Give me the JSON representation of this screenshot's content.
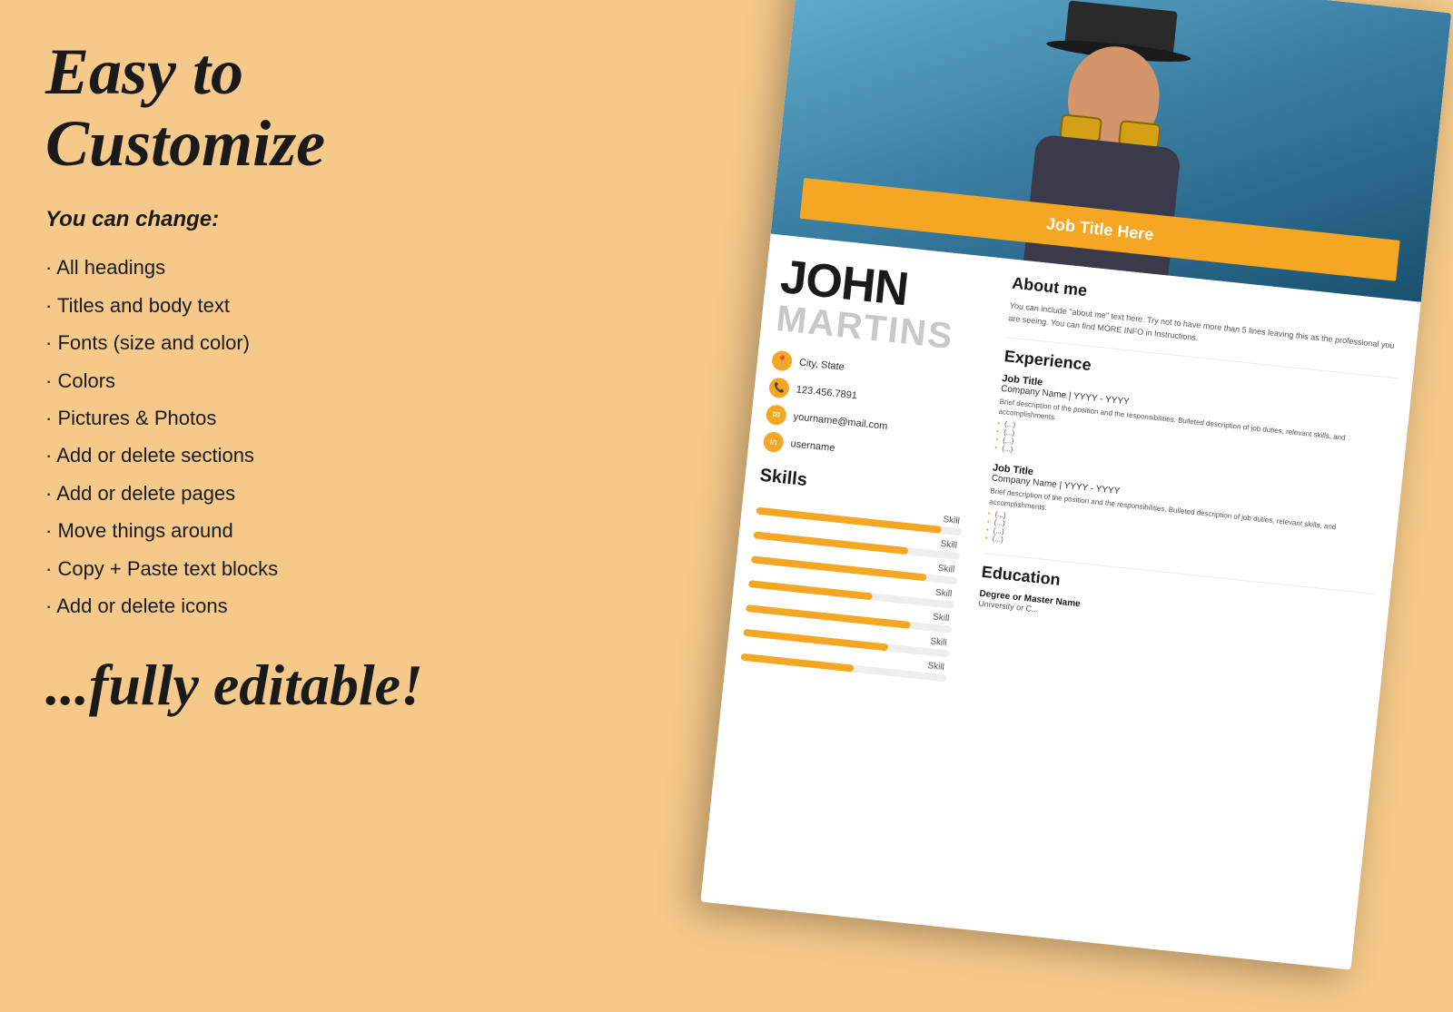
{
  "left": {
    "main_title": "Easy to Customize",
    "subtitle": "You can change:",
    "features": [
      "All headings",
      "Titles and body text",
      "Fonts (size and color)",
      "Colors",
      "Pictures & Photos",
      "Add or delete sections",
      "Add or delete pages",
      "Move things around",
      "Copy + Paste text blocks",
      "Add or delete icons"
    ],
    "tagline": "...fully editable!"
  },
  "resume": {
    "job_title_banner": "Job Title Here",
    "name_first": "JOHN",
    "name_last": "MARTINS",
    "contact": {
      "location": "City, State",
      "phone": "123.456.7891",
      "email": "yourname@mail.com",
      "linkedin": "username"
    },
    "skills_title": "Skills",
    "skills": [
      {
        "label": "Skill",
        "percent": 90
      },
      {
        "label": "Skill",
        "percent": 75
      },
      {
        "label": "Skill",
        "percent": 85
      },
      {
        "label": "Skill",
        "percent": 60
      },
      {
        "label": "Skill",
        "percent": 80
      },
      {
        "label": "Skill",
        "percent": 70
      },
      {
        "label": "Skill",
        "percent": 55
      }
    ],
    "about_title": "About me",
    "about_text": "You can include \"about me\" text here. Try not to have more than 5 lines leaving this as the professional you are seeing. You can find MORE INFO in Instructions.",
    "experience_title": "Experience",
    "jobs": [
      {
        "title": "Job Title",
        "company": "Company Name | YYYY - YYYY",
        "desc": "Brief description of the position and the responsibilities. Bulleted description of job duties, relevant skills, and accomplishments.",
        "bullets": [
          "(...)",
          "(...)",
          "(...)"
        ]
      },
      {
        "title": "Job Title",
        "company": "Company Name | YYYY - YYYY",
        "desc": "Brief description of the position and the responsibilities. Bulleted description of job duties, relevant skills, and accomplishments.",
        "bullets": [
          "(...)",
          "(...)",
          "(...)"
        ]
      }
    ],
    "education_title": "Education",
    "degree": "Degree or Master Name",
    "university": "University or C..."
  }
}
